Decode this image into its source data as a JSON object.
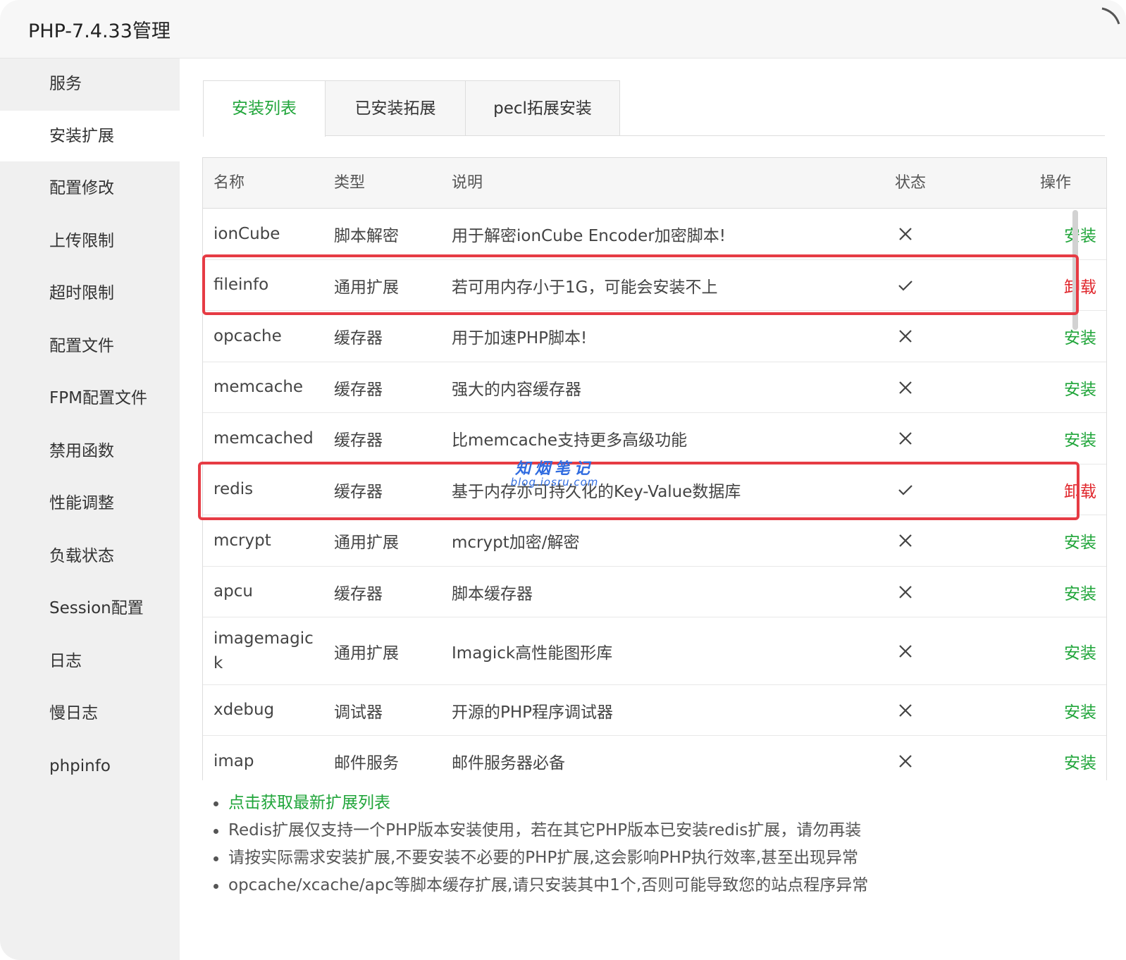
{
  "window": {
    "title": "PHP-7.4.33管理"
  },
  "sidebar": {
    "items": [
      {
        "label": "服务",
        "active": false
      },
      {
        "label": "安装扩展",
        "active": true
      },
      {
        "label": "配置修改",
        "active": false
      },
      {
        "label": "上传限制",
        "active": false
      },
      {
        "label": "超时限制",
        "active": false
      },
      {
        "label": "配置文件",
        "active": false
      },
      {
        "label": "FPM配置文件",
        "active": false
      },
      {
        "label": "禁用函数",
        "active": false
      },
      {
        "label": "性能调整",
        "active": false
      },
      {
        "label": "负载状态",
        "active": false
      },
      {
        "label": "Session配置",
        "active": false
      },
      {
        "label": "日志",
        "active": false
      },
      {
        "label": "慢日志",
        "active": false
      },
      {
        "label": "phpinfo",
        "active": false
      }
    ]
  },
  "tabs": [
    {
      "label": "安装列表",
      "active": true
    },
    {
      "label": "已安装拓展",
      "active": false
    },
    {
      "label": "pecl拓展安装",
      "active": false
    }
  ],
  "table": {
    "headers": [
      "名称",
      "类型",
      "说明",
      "状态",
      "操作"
    ],
    "rows": [
      {
        "name": "ionCube",
        "type": "脚本解密",
        "desc": "用于解密ionCube Encoder加密脚本!",
        "status": "cross-icon",
        "op": "安装",
        "installed": false
      },
      {
        "name": "fileinfo",
        "type": "通用扩展",
        "desc": "若可用内存小于1G，可能会安装不上",
        "status": "check-icon",
        "op": "卸载",
        "installed": true
      },
      {
        "name": "opcache",
        "type": "缓存器",
        "desc": "用于加速PHP脚本!",
        "status": "cross-icon",
        "op": "安装",
        "installed": false
      },
      {
        "name": "memcache",
        "type": "缓存器",
        "desc": "强大的内容缓存器",
        "status": "cross-icon",
        "op": "安装",
        "installed": false
      },
      {
        "name": "memcached",
        "type": "缓存器",
        "desc": "比memcache支持更多高级功能",
        "status": "cross-icon",
        "op": "安装",
        "installed": false
      },
      {
        "name": "redis",
        "type": "缓存器",
        "desc": "基于内存亦可持久化的Key-Value数据库",
        "status": "check-icon",
        "op": "卸载",
        "installed": true
      },
      {
        "name": "mcrypt",
        "type": "通用扩展",
        "desc": "mcrypt加密/解密",
        "status": "cross-icon",
        "op": "安装",
        "installed": false
      },
      {
        "name": "apcu",
        "type": "缓存器",
        "desc": "脚本缓存器",
        "status": "cross-icon",
        "op": "安装",
        "installed": false
      },
      {
        "name": "imagemagick",
        "type": "通用扩展",
        "desc": "Imagick高性能图形库",
        "status": "cross-icon",
        "op": "安装",
        "installed": false
      },
      {
        "name": "xdebug",
        "type": "调试器",
        "desc": "开源的PHP程序调试器",
        "status": "cross-icon",
        "op": "安装",
        "installed": false
      },
      {
        "name": "imap",
        "type": "邮件服务",
        "desc": "邮件服务器必备",
        "status": "cross-icon",
        "op": "安装",
        "installed": false
      }
    ]
  },
  "watermark": {
    "main": "知烟笔记",
    "sub": "blog.iosru.com"
  },
  "notes": [
    {
      "text": "点击获取最新扩展列表",
      "link": true
    },
    {
      "text": "Redis扩展仅支持一个PHP版本安装使用，若在其它PHP版本已安装redis扩展，请勿再装",
      "link": false
    },
    {
      "text": "请按实际需求安装扩展,不要安装不必要的PHP扩展,这会影响PHP执行效率,甚至出现异常",
      "link": false
    },
    {
      "text": "opcache/xcache/apc等脚本缓存扩展,请只安装其中1个,否则可能导致您的站点程序异常",
      "link": false
    }
  ],
  "colors": {
    "accent": "#20a53a",
    "danger": "#e0262c",
    "highlight": "#e63b44"
  }
}
